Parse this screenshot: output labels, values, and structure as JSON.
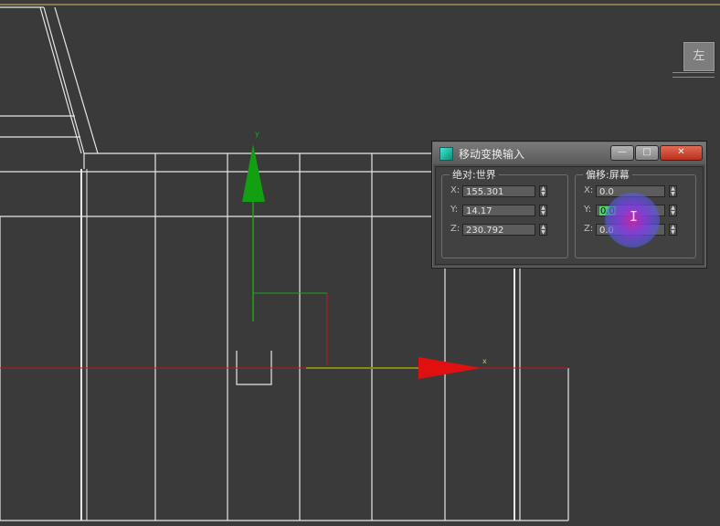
{
  "viewcube": {
    "label": "左"
  },
  "dialog": {
    "title": "移动变换输入",
    "controls": {
      "minimize": "—",
      "maximize": "□",
      "close": "✕"
    },
    "absolute_group": {
      "title": "绝对:世界",
      "rows": [
        {
          "axis": "X:",
          "value": "155.301"
        },
        {
          "axis": "Y:",
          "value": "14.17"
        },
        {
          "axis": "Z:",
          "value": "230.792"
        }
      ]
    },
    "offset_group": {
      "title": "偏移:屏幕",
      "rows": [
        {
          "axis": "X:",
          "value": "0.0"
        },
        {
          "axis": "Y:",
          "value": "0.0"
        },
        {
          "axis": "Z:",
          "value": "0.0"
        }
      ]
    }
  },
  "gizmo": {
    "y_label": "y",
    "x_label": "x"
  },
  "colors": {
    "viewport_bg": "#3a3a3a",
    "wireframe": "#e6e6e6",
    "gizmo_y": "#1aa51a",
    "gizmo_x": "#e01010",
    "cursor_highlight": "#8a3ce6",
    "input_selection": "#4fd36a"
  }
}
